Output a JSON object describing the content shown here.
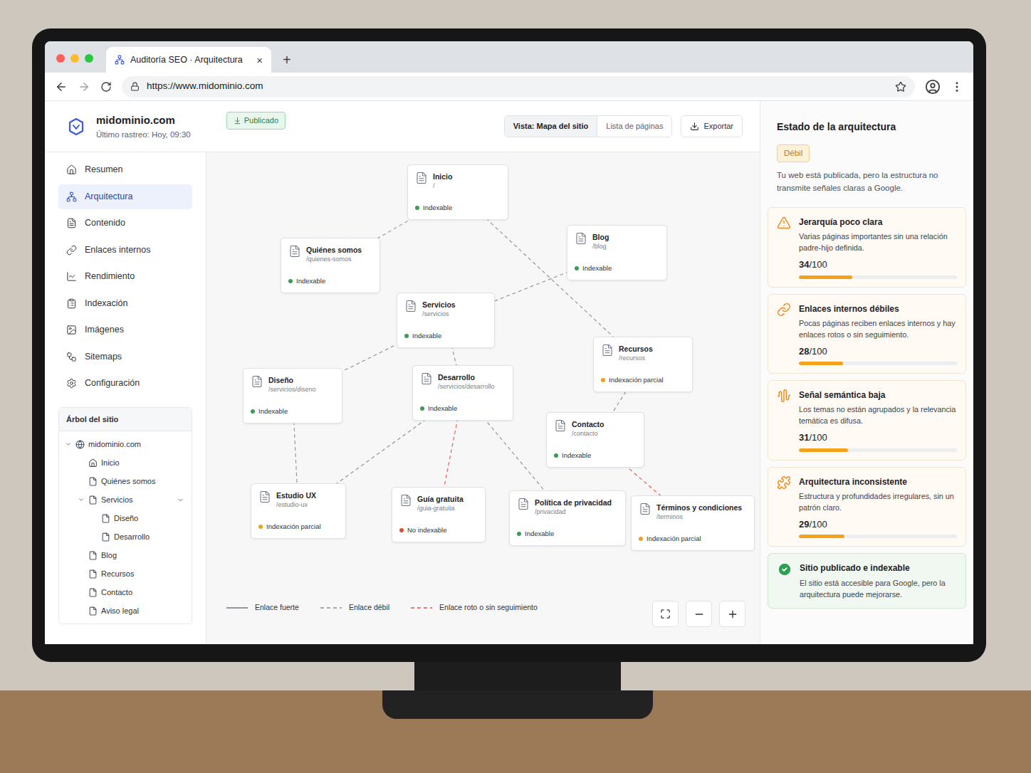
{
  "browser": {
    "tab": {
      "title": "Auditoría SEO · Arquitectura",
      "close_glyph": "×"
    },
    "new_tab_glyph": "+",
    "url": "https://www.midominio.com"
  },
  "header": {
    "site": "midominio.com",
    "last_crawl": "Último rastreo: Hoy, 09:30",
    "status_badge": "Publicado",
    "views": [
      {
        "label": "Vista: Mapa del sitio",
        "selected": true
      },
      {
        "label": "Lista de páginas",
        "selected": false
      }
    ],
    "export": "Exportar"
  },
  "sidebar": {
    "items": [
      {
        "label": "Resumen",
        "selected": false
      },
      {
        "label": "Arquitectura",
        "selected": true
      },
      {
        "label": "Contenido",
        "selected": false
      },
      {
        "label": "Enlaces internos",
        "selected": false
      },
      {
        "label": "Rendimiento",
        "selected": false
      },
      {
        "label": "Indexación",
        "selected": false
      },
      {
        "label": "Imágenes",
        "selected": false
      },
      {
        "label": "Sitemaps",
        "selected": false
      },
      {
        "label": "Configuración",
        "selected": false
      }
    ],
    "tree": {
      "title": "Árbol del sitio",
      "items": [
        {
          "label": "midominio.com",
          "depth": 0,
          "kind": "site",
          "expandable": true,
          "expanded": true
        },
        {
          "label": "Inicio",
          "depth": 1,
          "kind": "home",
          "expandable": false,
          "expanded": false
        },
        {
          "label": "Quiénes somos",
          "depth": 1,
          "kind": "page",
          "expandable": false,
          "expanded": false
        },
        {
          "label": "Servicios",
          "depth": 1,
          "kind": "page",
          "expandable": true,
          "expanded": true
        },
        {
          "label": "Diseño",
          "depth": 2,
          "kind": "page",
          "expandable": false,
          "expanded": false
        },
        {
          "label": "Desarrollo",
          "depth": 2,
          "kind": "page",
          "expandable": false,
          "expanded": false
        },
        {
          "label": "Blog",
          "depth": 1,
          "kind": "page",
          "expandable": false,
          "expanded": false
        },
        {
          "label": "Recursos",
          "depth": 1,
          "kind": "page",
          "expandable": false,
          "expanded": false
        },
        {
          "label": "Contacto",
          "depth": 1,
          "kind": "page",
          "expandable": false,
          "expanded": false
        },
        {
          "label": "Aviso legal",
          "depth": 1,
          "kind": "page",
          "expandable": false,
          "expanded": false
        }
      ]
    }
  },
  "canvas": {
    "nodes": [
      {
        "title": "Inicio",
        "path": "/",
        "status": "Indexable",
        "color": "#3f9b55"
      },
      {
        "title": "Quiénes somos",
        "path": "/quienes-somos",
        "status": "Indexable",
        "color": "#3f9b55"
      },
      {
        "title": "Blog",
        "path": "/blog",
        "status": "Indexable",
        "color": "#3f9b55"
      },
      {
        "title": "Servicios",
        "path": "/servicios",
        "status": "Indexable",
        "color": "#3f9b55"
      },
      {
        "title": "Recursos",
        "path": "/recursos",
        "status": "Indexación parcial",
        "color": "#f0a020"
      },
      {
        "title": "Diseño",
        "path": "/servicios/diseno",
        "status": "Indexable",
        "color": "#3f9b55"
      },
      {
        "title": "Desarrollo",
        "path": "/servicios/desarrollo",
        "status": "Indexable",
        "color": "#3f9b55"
      },
      {
        "title": "Contacto",
        "path": "/contacto",
        "status": "Indexable",
        "color": "#3f9b55"
      },
      {
        "title": "Estudio UX",
        "path": "/estudio-ux",
        "status": "Indexación parcial",
        "color": "#f0a020"
      },
      {
        "title": "Guía gratuita",
        "path": "/guia-gratuita",
        "status": "No indexable",
        "color": "#e04a3a"
      },
      {
        "title": "Política de privacidad",
        "path": "/privacidad",
        "status": "Indexable",
        "color": "#3f9b55"
      },
      {
        "title": "Términos y condiciones",
        "path": "/terminos",
        "status": "Indexación parcial",
        "color": "#f0a020"
      }
    ],
    "edges": [
      {
        "from": "Inicio",
        "to": "Quiénes somos",
        "kind": "weak"
      },
      {
        "from": "Inicio",
        "to": "Recursos",
        "kind": "weak"
      },
      {
        "from": "Blog",
        "to": "Servicios",
        "kind": "weak"
      },
      {
        "from": "Servicios",
        "to": "Diseño",
        "kind": "weak"
      },
      {
        "from": "Servicios",
        "to": "Desarrollo",
        "kind": "weak"
      },
      {
        "from": "Recursos",
        "to": "Contacto",
        "kind": "weak"
      },
      {
        "from": "Diseño",
        "to": "Estudio UX",
        "kind": "weak"
      },
      {
        "from": "Desarrollo",
        "to": "Estudio UX",
        "kind": "weak"
      },
      {
        "from": "Desarrollo",
        "to": "Guía gratuita",
        "kind": "broken"
      },
      {
        "from": "Desarrollo",
        "to": "Política de privacidad",
        "kind": "weak"
      },
      {
        "from": "Contacto",
        "to": "Términos y condiciones",
        "kind": "broken"
      }
    ],
    "legend": [
      {
        "label": "Enlace fuerte",
        "kind": "strong"
      },
      {
        "label": "Enlace débil",
        "kind": "weak"
      },
      {
        "label": "Enlace roto o sin seguimiento",
        "kind": "broken"
      }
    ]
  },
  "panel": {
    "title": "Estado de la arquitectura",
    "badge": "Débil",
    "description": "Tu web está publicada, pero la estructura no transmite señales claras a Google.",
    "cards": [
      {
        "kind": "issue",
        "title": "Jerarquía poco clara",
        "description": "Varias páginas importantes sin una relación padre-hijo definida.",
        "score": "34",
        "out_of": "/100",
        "level": 0.34
      },
      {
        "kind": "issue",
        "title": "Enlaces internos débiles",
        "description": "Pocas páginas reciben enlaces internos y hay enlaces rotos o sin seguimiento.",
        "score": "28",
        "out_of": "/100",
        "level": 0.28
      },
      {
        "kind": "issue",
        "title": "Señal semántica baja",
        "description": "Los temas no están agrupados y la relevancia temática es difusa.",
        "score": "31",
        "out_of": "/100",
        "level": 0.31
      },
      {
        "kind": "issue",
        "title": "Arquitectura inconsistente",
        "description": "Estructura y profundidades irregulares, sin un patrón claro.",
        "score": "29",
        "out_of": "/100",
        "level": 0.29
      },
      {
        "kind": "success",
        "title": "Sitio publicado e indexable",
        "description": "El sitio está accesible para Google, pero la arquitectura puede mejorarse."
      }
    ]
  }
}
